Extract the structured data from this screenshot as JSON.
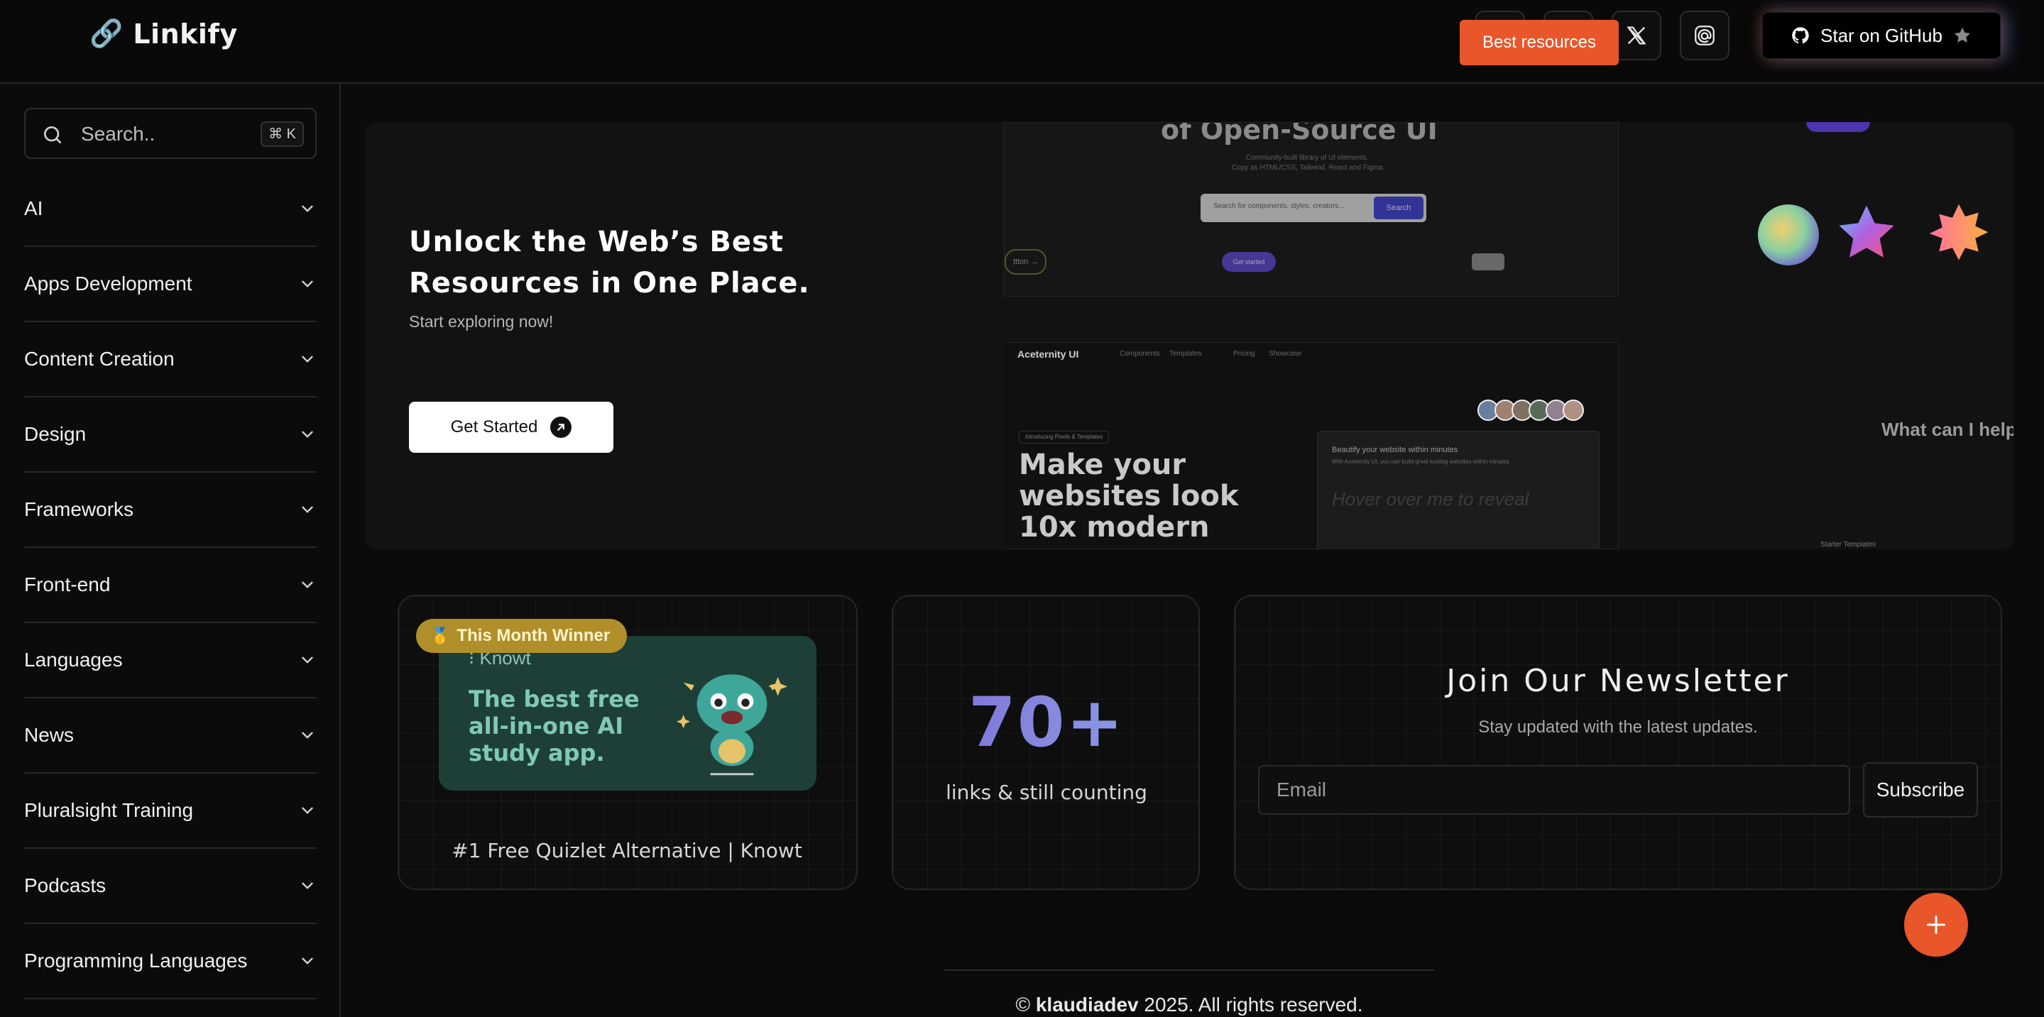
{
  "header": {
    "brand_icon": "link-icon",
    "brand_title": "Linkify",
    "icons": [
      "home-icon",
      "github-icon",
      "x-icon",
      "threads-icon"
    ],
    "github_button_label": "Star on GitHub"
  },
  "sidebar": {
    "search_placeholder": "Search..",
    "search_shortcut": "⌘ K",
    "items": [
      {
        "label": "AI"
      },
      {
        "label": "Apps Development"
      },
      {
        "label": "Content Creation"
      },
      {
        "label": "Design"
      },
      {
        "label": "Frameworks"
      },
      {
        "label": "Front-end"
      },
      {
        "label": "Languages"
      },
      {
        "label": "News"
      },
      {
        "label": "Pluralsight Training"
      },
      {
        "label": "Podcasts"
      },
      {
        "label": "Programming Languages"
      }
    ]
  },
  "hero": {
    "title": "Unlock the Web’s Best Resources in One Place.",
    "subtitle": "Start exploring now!",
    "cta_label": "Get Started",
    "badge_label": "Best resources",
    "collage": {
      "shot1_heading": "of Open-Source UI",
      "shot1_line1": "Community-built library of UI elements.",
      "shot1_line2": "Copy as HTML/CSS, Tailwind, React and Figma.",
      "shot1_search_placeholder": "Search for components, styles, creators...",
      "shot1_search_button": "Search",
      "shot1_pill_left": "ttton →",
      "shot1_pill_purple": "Get started",
      "shot2_brand": "Aceternity UI",
      "shot2_nav": [
        "Components",
        "Templates",
        "Pricing",
        "Showcase"
      ],
      "shot2_tag": "Introducing Pixels & Templates",
      "shot2_headline": "Make your websites look 10x modern",
      "shot2_card_title": "Beautify your website within minutes",
      "shot2_card_sub": "With Aceternity UI, you can build great looking websites within minutes",
      "shot2_card_hover": "Hover over me to reveal",
      "right_prompt": "What can I help",
      "right_caption": "Starter Templates"
    }
  },
  "featured": {
    "badge_icon": "medal-icon",
    "badge_label": "This Month Winner",
    "image_brand": "⁝ Knowt",
    "image_tagline": "The best free all-in-one AI study app.",
    "caption": "#1 Free Quizlet Alternative | Knowt"
  },
  "stats": {
    "count": "70+",
    "caption": "links & still counting"
  },
  "newsletter": {
    "title": "Join Our Newsletter",
    "subtitle": "Stay updated with the latest updates.",
    "email_placeholder": "Email",
    "subscribe_label": "Subscribe"
  },
  "fab": {
    "icon": "plus-icon"
  },
  "footer": {
    "prefix": "© ",
    "author": "klaudiadev",
    "suffix": " 2025. All rights reserved."
  },
  "colors": {
    "accent_orange": "#e8562a",
    "badge_gold": "#b08f2a",
    "knowt_green": "#1e3f37"
  }
}
